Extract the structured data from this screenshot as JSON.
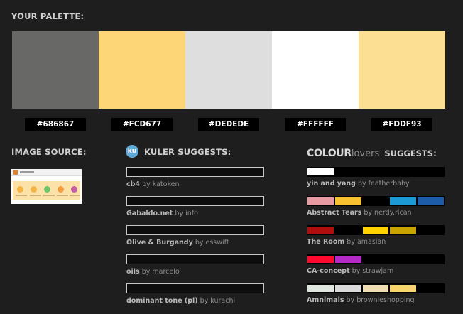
{
  "palette": {
    "title": "YOUR PALETTE:",
    "swatches": [
      {
        "hex": "#686867",
        "color": "#686867"
      },
      {
        "hex": "#FCD677",
        "color": "#FCD677"
      },
      {
        "hex": "#DEDEDE",
        "color": "#DEDEDE"
      },
      {
        "hex": "#FFFFFF",
        "color": "#FFFFFF"
      },
      {
        "hex": "#FDDF93",
        "color": "#FDDF93"
      }
    ]
  },
  "image_source": {
    "title": "IMAGE SOURCE:",
    "thumb_dot_colors": [
      "#f6b445",
      "#f6b445",
      "#6fc36a",
      "#f39a3b",
      "#c35ba7"
    ]
  },
  "kuler": {
    "logo_text": "ku",
    "title": "KULER SUGGESTS:",
    "items": [
      {
        "name": "cb4",
        "by": "by katoken"
      },
      {
        "name": "Gabaldo.net",
        "by": "by info"
      },
      {
        "name": "Olive & Burgandy",
        "by": "by esswift"
      },
      {
        "name": "oils",
        "by": "by marcelo"
      },
      {
        "name": "dominant tone (pl)",
        "by": "by kurachi"
      }
    ]
  },
  "colourlovers": {
    "brand_a": "COLOUR",
    "brand_b": "lovers",
    "title": "SUGGESTS:",
    "items": [
      {
        "name": "yin and yang",
        "by": "by featherbaby",
        "colors": [
          "#ffffff",
          "#000000",
          "#000000",
          "#000000",
          "#000000"
        ]
      },
      {
        "name": "Abstract Tears",
        "by": "by nerdy.rican",
        "colors": [
          "#e89aa3",
          "#f7c130",
          "#000000",
          "#1c9ad6",
          "#1c5ca8"
        ]
      },
      {
        "name": "The Room",
        "by": "by amasian",
        "colors": [
          "#b00d0d",
          "#000000",
          "#ffd200",
          "#c9a300",
          "#000000"
        ]
      },
      {
        "name": "CA-concept",
        "by": "by strawjam",
        "colors": [
          "#ff0a2e",
          "#b52ac6",
          "#000000",
          "#000000",
          "#000000"
        ]
      },
      {
        "name": "Amnimals",
        "by": "by brownieshopping",
        "colors": [
          "#dfe6df",
          "#d9d9d9",
          "#f0deb0",
          "#f7d36f",
          "#000000"
        ]
      }
    ]
  }
}
